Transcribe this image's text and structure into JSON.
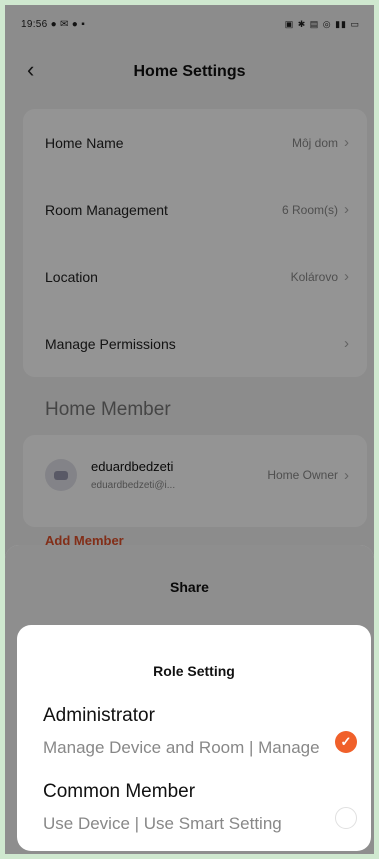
{
  "status_bar": {
    "time_icons": "19:56 ● ✉ ● ▪",
    "right_icons": "▣ ✱ ▤ ◎ ▮▮ ▭"
  },
  "header": {
    "back_icon": "chevron-left-icon",
    "title": "Home Settings"
  },
  "settings": {
    "rows": [
      {
        "label": "Home Name",
        "value": "Môj dom"
      },
      {
        "label": "Room Management",
        "value": "6 Room(s)"
      },
      {
        "label": "Location",
        "value": "Kolárovo"
      },
      {
        "label": "Manage Permissions",
        "value": ""
      }
    ]
  },
  "members": {
    "section_title": "Home Member",
    "items": [
      {
        "name": "eduardbedzeti",
        "email": "eduardbedzeti@i...",
        "role": "Home Owner"
      }
    ],
    "add_label": "Add Member"
  },
  "share_sheet": {
    "title": "Share"
  },
  "role_sheet": {
    "title": "Role Setting",
    "options": [
      {
        "name": "Administrator",
        "description": "Manage Device and Room | Manage Smart Setting |",
        "selected": true
      },
      {
        "name": "Common Member",
        "description": "Use Device | Use Smart Setting",
        "selected": false
      }
    ]
  },
  "colors": {
    "accent": "#f0602a",
    "background": "#f2f2f2"
  }
}
